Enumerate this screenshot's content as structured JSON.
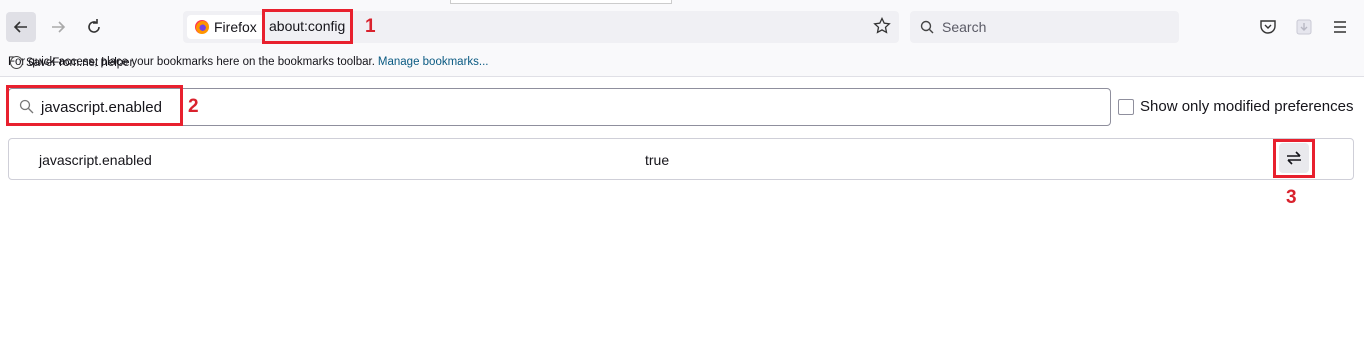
{
  "toolbar": {
    "identity_label": "Firefox",
    "url": "about:config",
    "search_placeholder": "Search"
  },
  "bookmarks_bar": {
    "message": "For quick access, place your bookmarks here on the bookmarks toolbar.",
    "manage_link": "Manage bookmarks...",
    "overlay_text": "SaveFrom.net helper"
  },
  "config": {
    "search_value": "javascript.enabled",
    "modified_checkbox_label": "Show only modified preferences",
    "modified_checked": false,
    "preferences": [
      {
        "name": "javascript.enabled",
        "value": "true"
      }
    ]
  },
  "annotations": [
    "1",
    "2",
    "3"
  ],
  "colors": {
    "annotation": "#e8202e",
    "link": "#0a5a82",
    "toolbar_bg": "#f9f9fb"
  }
}
